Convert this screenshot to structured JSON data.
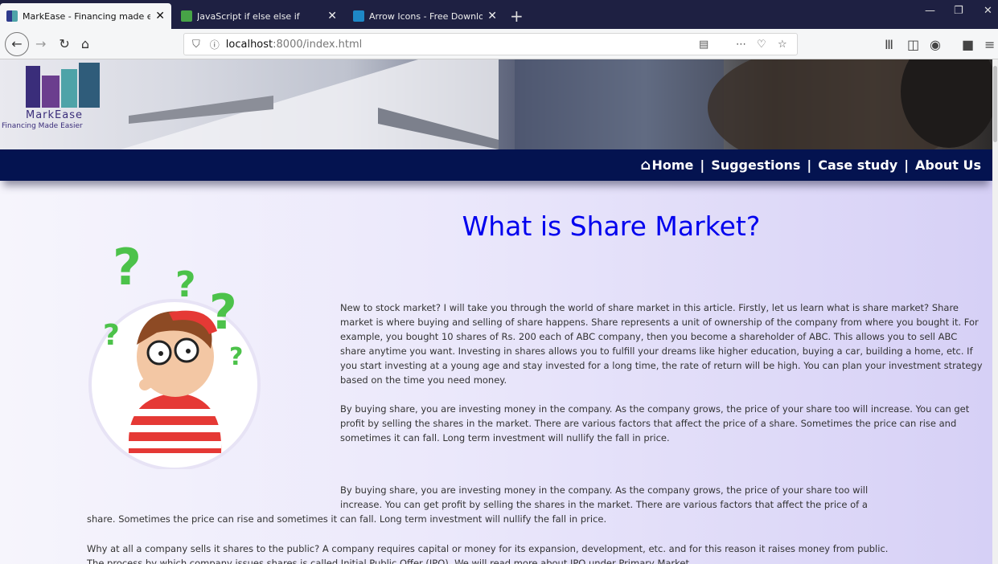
{
  "browser": {
    "tabs": [
      {
        "title": "MarkEase - Financing made eas",
        "active": true,
        "favicon_color": "#2e3a8c"
      },
      {
        "title": "JavaScript if else else if",
        "active": false,
        "favicon_color": "#47a447"
      },
      {
        "title": "Arrow Icons - Free Download, F",
        "active": false,
        "favicon_color": "#1e88c7"
      }
    ],
    "url_host": "localhost",
    "url_path": ":8000/index.html"
  },
  "site": {
    "logo_name": "MarkEase",
    "logo_tagline": "Financing Made Easier",
    "nav": {
      "home": "Home",
      "sep": "|",
      "suggestions": "Suggestions",
      "case_study": "Case study",
      "about": "About Us"
    },
    "title": "What is Share Market?",
    "paragraphs": [
      "New to stock market? I will take you through the world of share market in this article. Firstly, let us learn what is share market? Share market is where buying and selling of share happens. Share represents a unit of ownership of the company from where you bought it. For example, you bought 10 shares of Rs. 200 each of ABC company, then you become a shareholder of ABC. This allows you to sell ABC share anytime you want. Investing in shares allows you to fulfill your dreams like higher education, buying a car, building a home, etc. If you start investing at a young age and stay invested for a long time, the rate of return will be high. You can plan your investment strategy based on the time you need money.",
      "By buying share, you are investing money in the company. As the company grows, the price of your share too will increase. You can get profit by selling the shares in the market. There are various factors that affect the price of a share. Sometimes the price can rise and sometimes it can fall. Long term investment will nullify the fall in price."
    ],
    "para3_line1": "By buying share, you are investing money in the company. As the company grows, the price of your share too will",
    "para3_line2": "increase. You can get profit by selling the shares in the market. There are various factors that affect the price of a",
    "para3_line3": "share. Sometimes the price can rise and sometimes it can fall. Long term investment will nullify the fall in price.",
    "para4_line1": "Why at all a company sells it shares to the public? A company requires capital or money for its expansion, development, etc. and for this reason it raises money from public.",
    "para4_line2": "The process by which company issues shares is called Initial Public Offer (IPO). We will read more about IPO under Primary Market."
  },
  "colors": {
    "nav_bg": "#041350",
    "title": "#0000ee",
    "tab_strip": "#1e2042"
  }
}
